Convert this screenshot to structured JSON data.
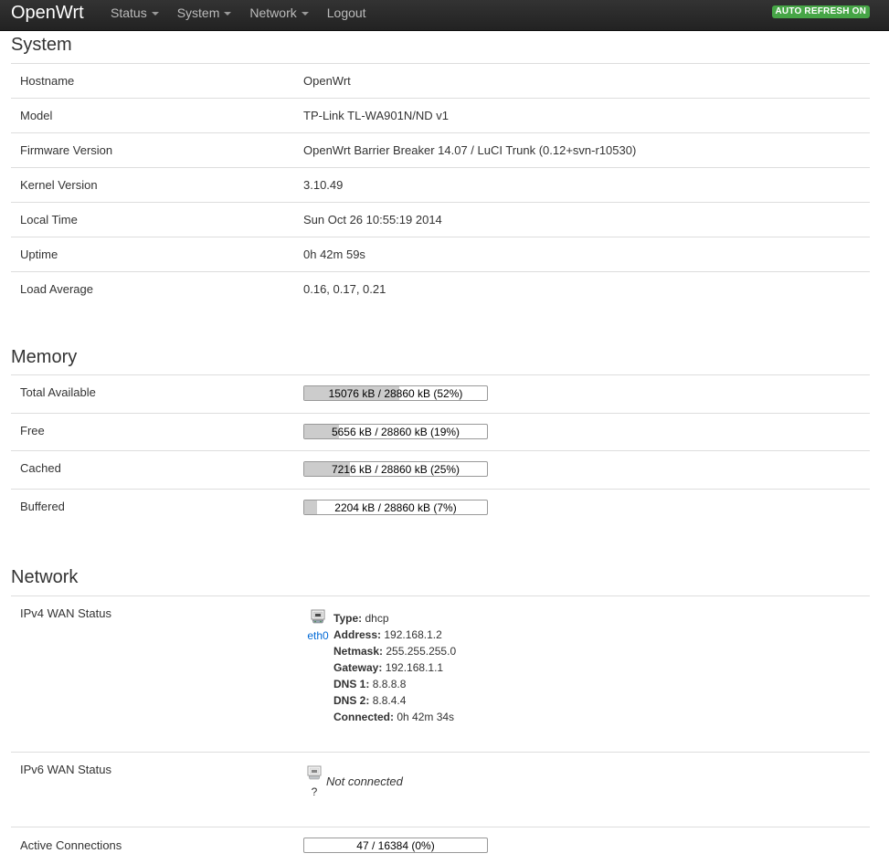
{
  "navbar": {
    "brand": "OpenWrt",
    "menu": [
      {
        "label": "Status",
        "dropdown": true
      },
      {
        "label": "System",
        "dropdown": true
      },
      {
        "label": "Network",
        "dropdown": true
      },
      {
        "label": "Logout",
        "dropdown": false
      }
    ],
    "auto_refresh": "AUTO REFRESH ON"
  },
  "system": {
    "title": "System",
    "rows": [
      {
        "label": "Hostname",
        "value": "OpenWrt"
      },
      {
        "label": "Model",
        "value": "TP-Link TL-WA901N/ND v1"
      },
      {
        "label": "Firmware Version",
        "value": "OpenWrt Barrier Breaker 14.07 / LuCI Trunk (0.12+svn-r10530)"
      },
      {
        "label": "Kernel Version",
        "value": "3.10.49"
      },
      {
        "label": "Local Time",
        "value": "Sun Oct 26 10:55:19 2014"
      },
      {
        "label": "Uptime",
        "value": "0h 42m 59s"
      },
      {
        "label": "Load Average",
        "value": "0.16, 0.17, 0.21"
      }
    ]
  },
  "memory": {
    "title": "Memory",
    "rows": [
      {
        "label": "Total Available",
        "bar_text": "15076 kB / 28860 kB (52%)",
        "percent": 52
      },
      {
        "label": "Free",
        "bar_text": "5656 kB / 28860 kB (19%)",
        "percent": 19
      },
      {
        "label": "Cached",
        "bar_text": "7216 kB / 28860 kB (25%)",
        "percent": 25
      },
      {
        "label": "Buffered",
        "bar_text": "2204 kB / 28860 kB (7%)",
        "percent": 7
      }
    ]
  },
  "network": {
    "title": "Network",
    "ipv4": {
      "label": "IPv4 WAN Status",
      "interface": "eth0",
      "fields": [
        {
          "key": "Type:",
          "value": "dhcp"
        },
        {
          "key": "Address:",
          "value": "192.168.1.2"
        },
        {
          "key": "Netmask:",
          "value": "255.255.255.0"
        },
        {
          "key": "Gateway:",
          "value": "192.168.1.1"
        },
        {
          "key": "DNS 1:",
          "value": "8.8.8.8"
        },
        {
          "key": "DNS 2:",
          "value": "8.8.4.4"
        },
        {
          "key": "Connected:",
          "value": "0h 42m 34s"
        }
      ]
    },
    "ipv6": {
      "label": "IPv6 WAN Status",
      "interface": "?",
      "status": "Not connected"
    },
    "active_connections": {
      "label": "Active Connections",
      "bar_text": "47 / 16384 (0%)",
      "percent": 0
    }
  },
  "colors": {
    "navbar": "#222222",
    "badge": "#46a546",
    "link": "#0069d6",
    "bar_fill": "#cccccc"
  }
}
